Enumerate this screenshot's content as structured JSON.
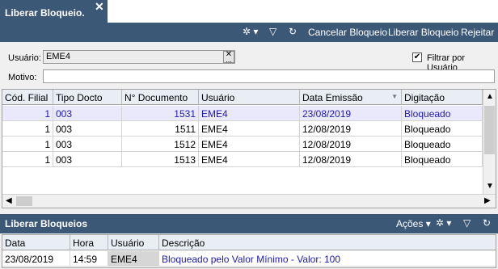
{
  "tab": {
    "title": "Liberar Bloqueio.",
    "close": "✕"
  },
  "toolbar": {
    "filter_icon": "funnel-icon",
    "refresh_icon": "refresh-icon",
    "settings_icon": "gear-icon",
    "cancel_label": "Cancelar Bloqueio",
    "release_label": "Liberar Bloqueio",
    "reject_label": "Rejeitar"
  },
  "form": {
    "usuario_label": "Usuário:",
    "usuario_value": "EME4",
    "usuario_btn": "...",
    "filter_label": "Filtrar por Usuário",
    "filter_checked": "✔",
    "motivo_label": "Motivo:",
    "motivo_value": ""
  },
  "grid": {
    "columns": [
      "Cód. Filial",
      "Tipo Docto",
      "N° Documento",
      "Usuário",
      "Data Emissão",
      "Digitação"
    ],
    "rows": [
      [
        "1",
        "003",
        "1531",
        "EME4",
        "23/08/2019",
        "Bloqueado"
      ],
      [
        "1",
        "003",
        "1511",
        "EME4",
        "12/08/2019",
        "Bloqueado"
      ],
      [
        "1",
        "003",
        "1512",
        "EME4",
        "12/08/2019",
        "Bloqueado"
      ],
      [
        "1",
        "003",
        "1513",
        "EME4",
        "12/08/2019",
        "Bloqueado"
      ]
    ],
    "sort_indicator": "▼"
  },
  "panel": {
    "title": "Liberar Bloqueios",
    "actions_label": "Ações",
    "columns": [
      "Data",
      "Hora",
      "Usuário",
      "Descrição"
    ],
    "rows": [
      [
        "23/08/2019",
        "14:59",
        "EME4",
        "Bloqueado pelo Valor Mínimo - Valor: 100"
      ]
    ]
  },
  "colors": {
    "header_bg": "#3b5877",
    "selected_text": "#1d1ab9",
    "selected_bg": "#eae8fb"
  }
}
